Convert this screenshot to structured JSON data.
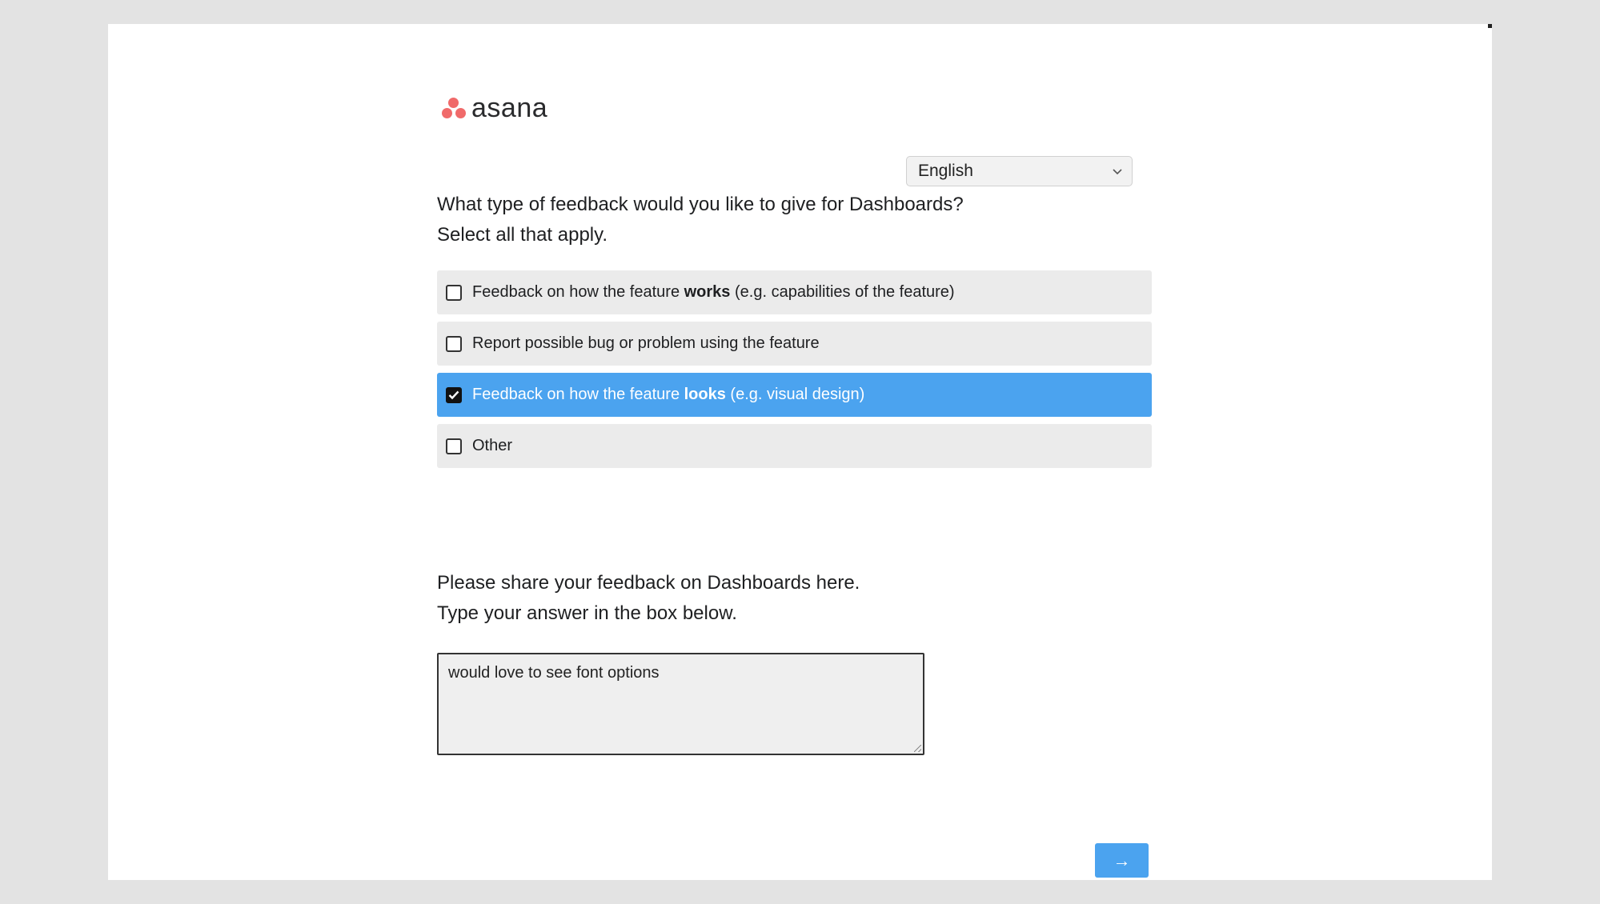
{
  "logo": {
    "text": "asana",
    "dot_color": "#f06a6a"
  },
  "language": {
    "selected": "English",
    "icon": "chevron-down-icon"
  },
  "question1": {
    "line1": "What type of feedback would you like to give for Dashboards?",
    "line2": "Select all that apply.",
    "options": [
      {
        "pre": "Feedback on how the feature ",
        "bold": "works",
        "post": " (e.g. capabilities of the feature)",
        "checked": false
      },
      {
        "pre": "Report possible bug or problem using the feature",
        "bold": "",
        "post": "",
        "checked": false
      },
      {
        "pre": "Feedback on how the feature ",
        "bold": "looks",
        "post": " (e.g. visual design)",
        "checked": true
      },
      {
        "pre": "Other",
        "bold": "",
        "post": "",
        "checked": false
      }
    ]
  },
  "question2": {
    "line1": "Please share your feedback on Dashboards here.",
    "line2": "Type your answer in the box below.",
    "answer": "would love to see font options"
  },
  "next_button": {
    "label": "→",
    "icon": "arrow-right-icon"
  },
  "colors": {
    "accent": "#4ba3ef",
    "option_bg": "#ebebeb",
    "page_bg": "#e3e3e3"
  }
}
